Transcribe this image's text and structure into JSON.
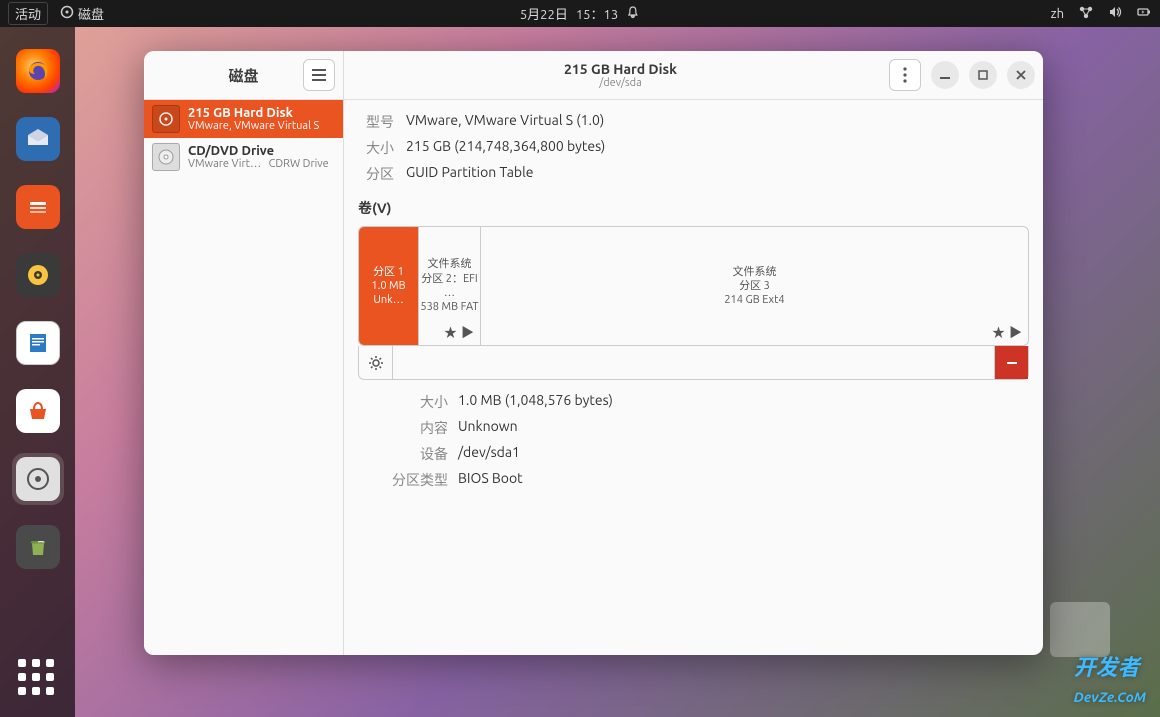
{
  "topbar": {
    "activities": "活动",
    "appname": "磁盘",
    "date": "5月22日",
    "time": "15：13",
    "input_method": "zh"
  },
  "window": {
    "sidebar_title": "磁盘",
    "title": "215 GB Hard Disk",
    "subtitle": "/dev/sda"
  },
  "drives": {
    "d0": {
      "name": "215 GB Hard Disk",
      "sub": "VMware, VMware Virtual S"
    },
    "d1": {
      "name": "CD/DVD Drive",
      "sub_a": "VMware Virt…",
      "sub_b": "CDRW Drive"
    }
  },
  "info": {
    "model_label": "型号",
    "model_value": "VMware, VMware Virtual S (1.0)",
    "size_label": "大小",
    "size_value": "215 GB (214,748,364,800 bytes)",
    "part_label": "分区",
    "part_value": "GUID Partition Table"
  },
  "vol_header": "卷(V)",
  "parts": {
    "p1": {
      "line1": "分区 1",
      "line2": "1.0 MB Unk…"
    },
    "p2": {
      "line1": "文件系统",
      "line2": "分区 2：EFI …",
      "line3": "538 MB FAT"
    },
    "p3": {
      "line1": "文件系统",
      "line2": "分区 3",
      "line3": "214 GB Ext4"
    }
  },
  "details": {
    "size_label": "大小",
    "size_value": "1.0 MB (1,048,576 bytes)",
    "content_label": "内容",
    "content_value": "Unknown",
    "device_label": "设备",
    "device_value": "/dev/sda1",
    "type_label": "分区类型",
    "type_value": "BIOS Boot"
  },
  "watermark": {
    "main": "开发者",
    "sub": "DevZe.CoM"
  }
}
